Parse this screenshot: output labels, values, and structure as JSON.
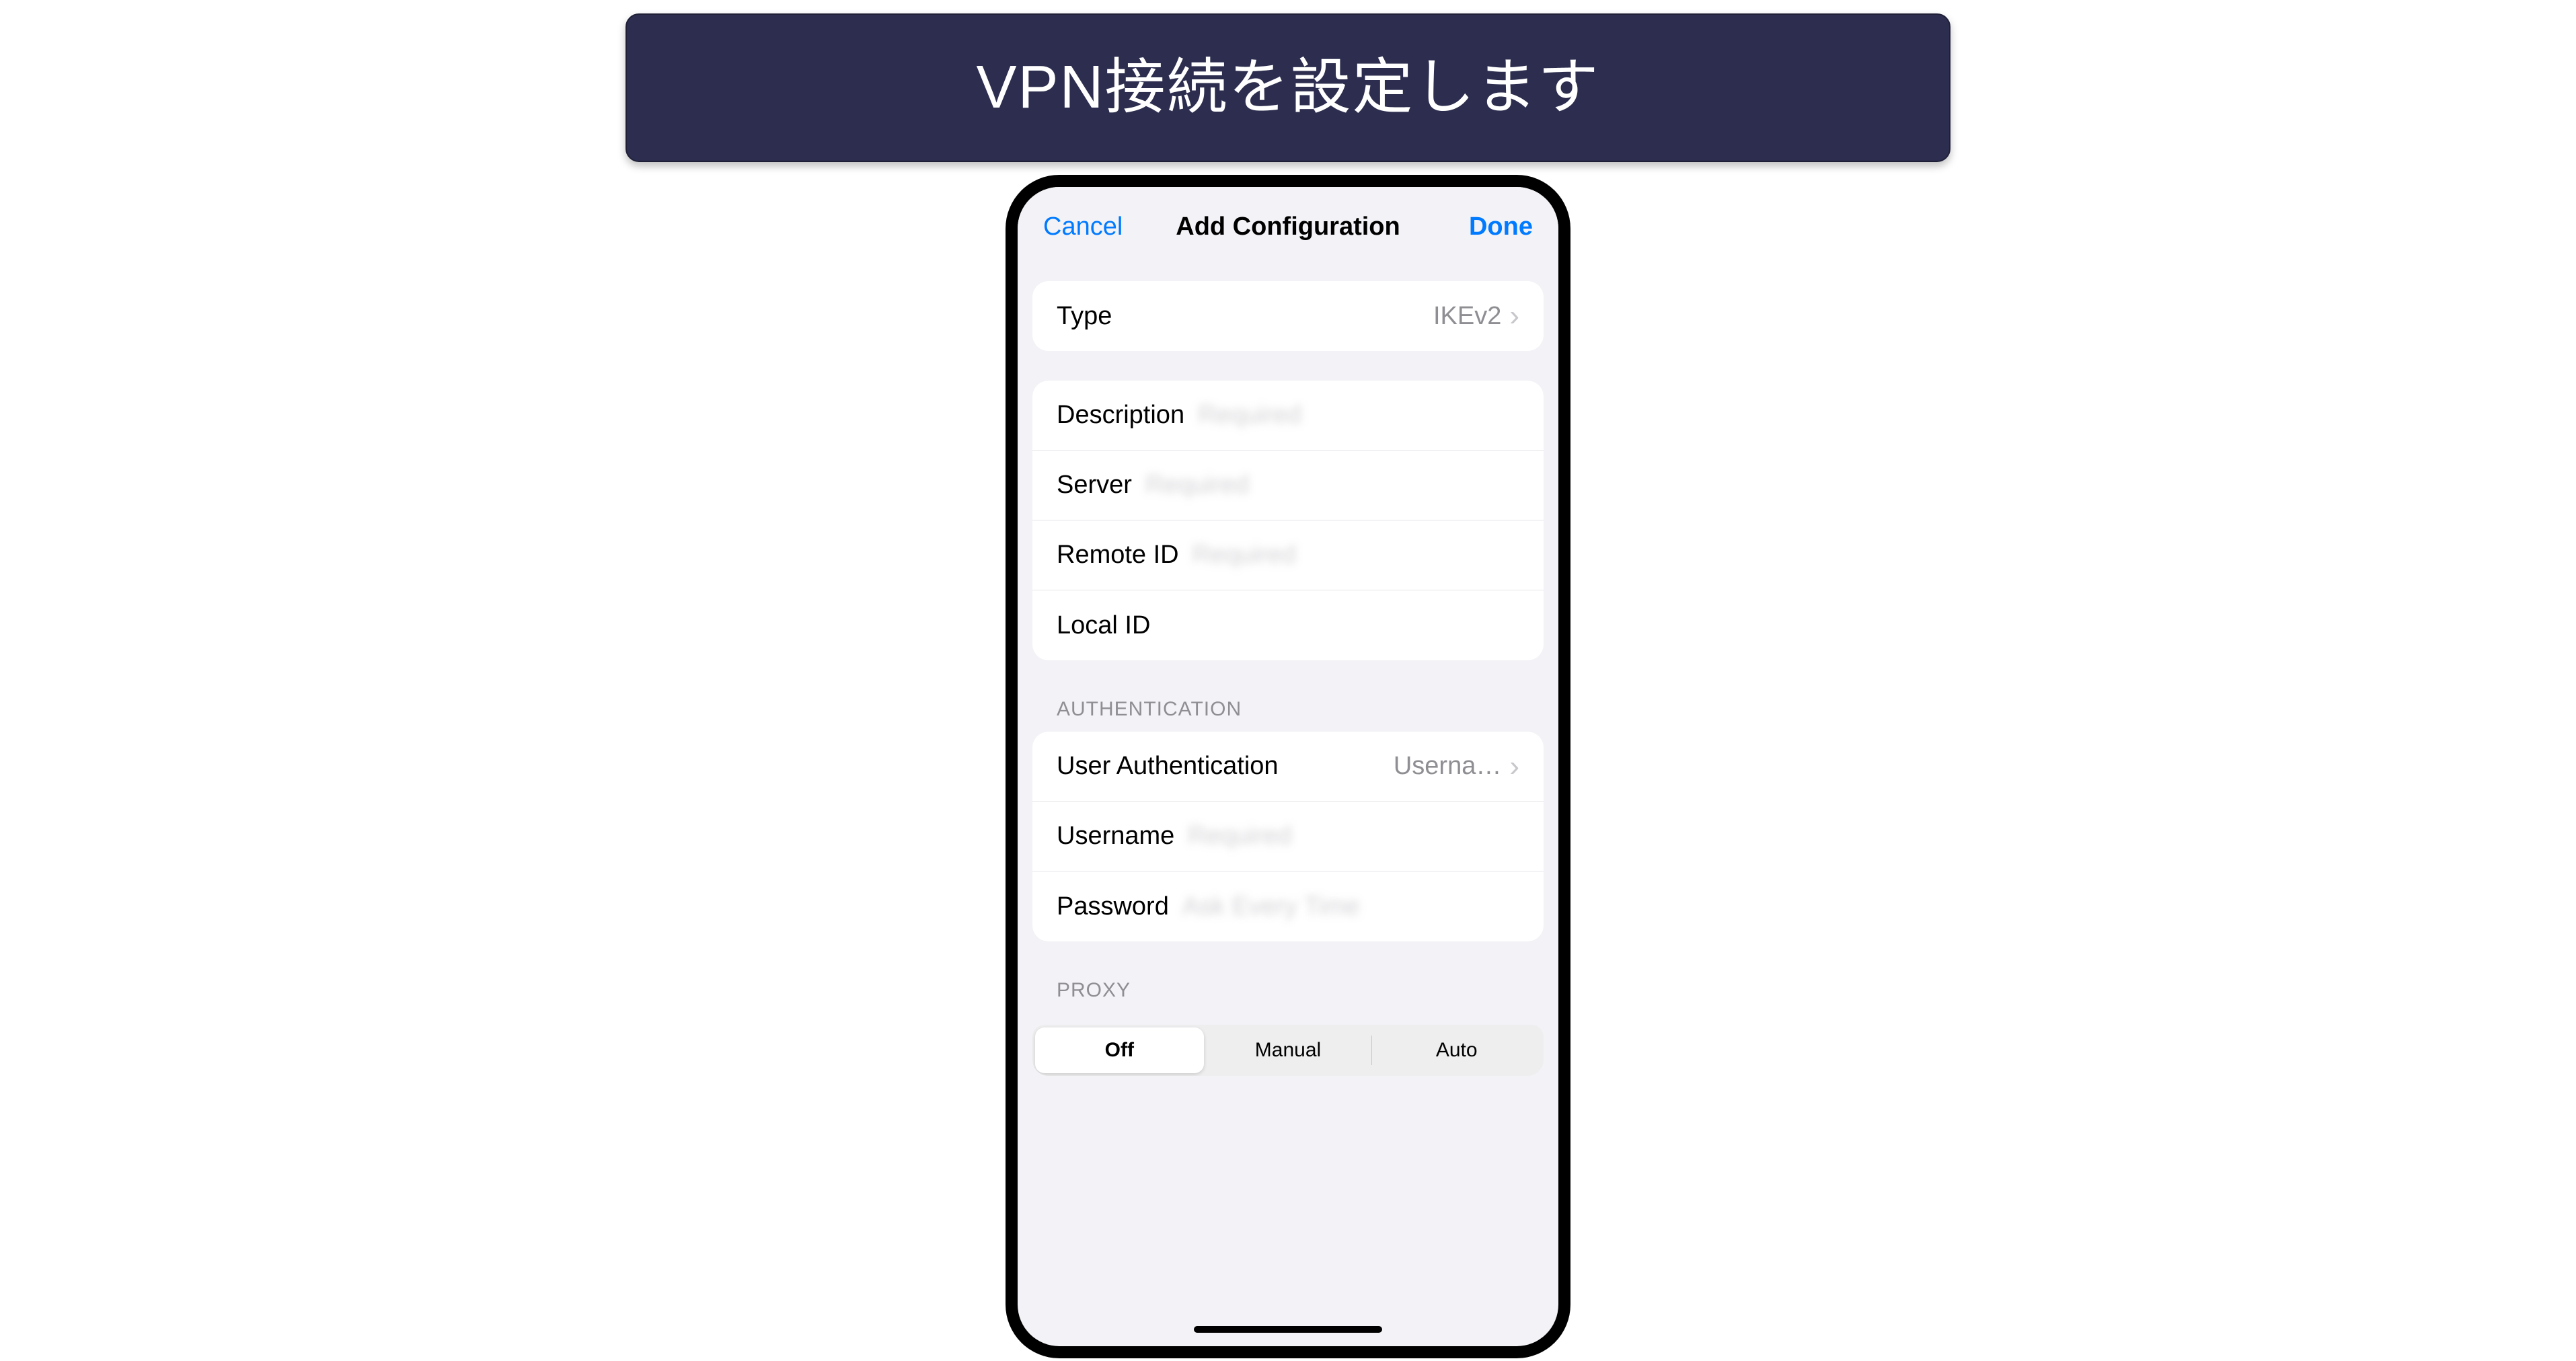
{
  "banner": {
    "text": "VPN接続を設定します"
  },
  "nav": {
    "cancel": "Cancel",
    "title": "Add Configuration",
    "done": "Done"
  },
  "type": {
    "label": "Type",
    "value": "IKEv2"
  },
  "conn": {
    "description": {
      "label": "Description",
      "placeholder": "Required"
    },
    "server": {
      "label": "Server",
      "placeholder": "Required"
    },
    "remote_id": {
      "label": "Remote ID",
      "placeholder": "Required"
    },
    "local_id": {
      "label": "Local ID",
      "placeholder": ""
    }
  },
  "auth": {
    "header": "AUTHENTICATION",
    "user_auth": {
      "label": "User Authentication",
      "value": "Userna…"
    },
    "username": {
      "label": "Username",
      "placeholder": "Required"
    },
    "password": {
      "label": "Password",
      "placeholder": "Ask Every Time"
    }
  },
  "proxy": {
    "header": "PROXY",
    "options": {
      "off": "Off",
      "manual": "Manual",
      "auto": "Auto"
    },
    "selected": "off"
  }
}
